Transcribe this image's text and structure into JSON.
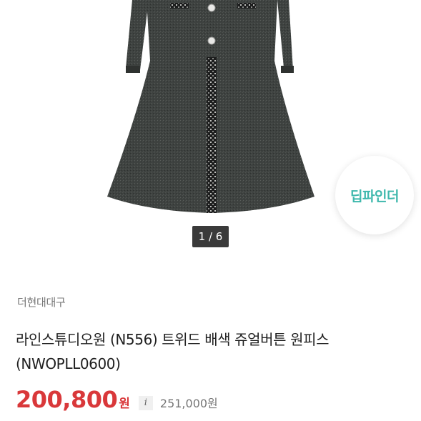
{
  "carousel": {
    "indicator": "1 / 6"
  },
  "badge": {
    "text": "딥파인더"
  },
  "product": {
    "seller": "더현대대구",
    "title": "라인스튜디오원 (N556) 트위드 배색 쥬얼버튼 원피스 (NWOPLL0600)",
    "sale_price": "200,800",
    "sale_currency": "원",
    "original_price": "251,000원",
    "info_icon": "i"
  },
  "colors": {
    "accent_red": "#d9383a",
    "badge_teal": "#3fb8ad",
    "pager_bg": "#3a3a3a"
  },
  "icons": {
    "info": "info-icon"
  }
}
